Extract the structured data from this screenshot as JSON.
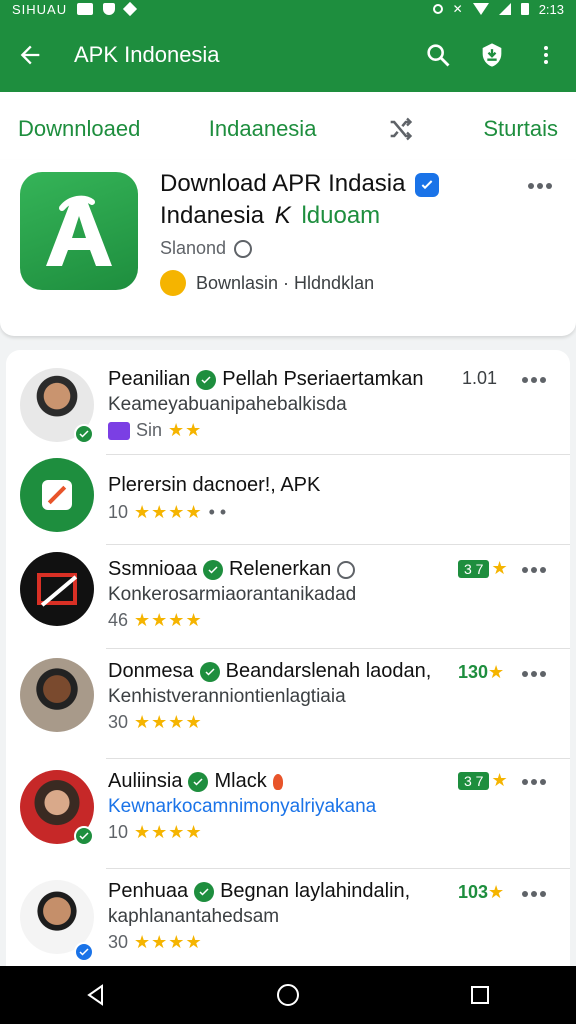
{
  "status_bar": {
    "left_text": "SIHUAU",
    "right_text": "2:13"
  },
  "app_bar": {
    "title": "APK Indonesia"
  },
  "tabs": [
    {
      "label": "Downnloaed"
    },
    {
      "label": "Indaanesia"
    },
    {
      "label": "Sturtais"
    }
  ],
  "hero": {
    "title_line1": "Download APR Indasia",
    "title_line2_main": "Indanesia",
    "title_line2_k": "K",
    "title_line2_accent": "lduoam",
    "sub_text": "Slanond",
    "meta_text": "Bownlasin · Hldndklan"
  },
  "rows": [
    {
      "title": "Peanilian",
      "title_tail": "Pellah Pseriaertamkan",
      "side_value": "1.01",
      "desc": "Keameyabuanipahebalkisda",
      "meta_count": "Sin",
      "stars": "★★",
      "has_more": true,
      "badge_color": "#1e8e3e",
      "desc_link": false
    },
    {
      "title": "Plerersin dacnoer!, APK",
      "title_tail": "",
      "side_value": "",
      "desc": "",
      "meta_count": "10",
      "stars": "★★★★",
      "has_more": false,
      "badge_color": "",
      "desc_link": false
    },
    {
      "title": "Ssmnioaa",
      "title_tail": "Relenerkan",
      "side_value": "3 7",
      "desc": "Konkerosarmiaorantanikadad",
      "meta_count": "46",
      "stars": "★★★★",
      "has_more": true,
      "badge_color": "",
      "desc_link": false
    },
    {
      "title": "Donmesa",
      "title_tail": "Beandarslenah laodan,",
      "side_value": "130",
      "desc": "Kenhistveranniontienlagtiaia",
      "meta_count": "30",
      "stars": "★★★★",
      "has_more": true,
      "badge_color": "",
      "desc_link": false
    },
    {
      "title": "Auliinsia",
      "title_tail": "Mlack",
      "side_value": "3 7",
      "desc": "Kewnarkocamnimonyalriyakana",
      "meta_count": "10",
      "stars": "★★★★",
      "has_more": true,
      "badge_color": "#1e8e3e",
      "desc_link": true
    },
    {
      "title": "Penhuaa",
      "title_tail": "Begnan laylahindalin,",
      "side_value": "103",
      "desc": "kaphlanantahedsam",
      "meta_count": "30",
      "stars": "★★★★",
      "has_more": true,
      "badge_color": "#1a73e8",
      "desc_link": false
    }
  ],
  "colors": {
    "primary": "#1e8e3e",
    "accent_blue": "#1a73e8",
    "star": "#f5b400"
  },
  "icons": [
    "back-arrow-icon",
    "search-icon",
    "download-shield-icon",
    "more-vert-icon",
    "shuffle-icon",
    "verified-icon",
    "more-horiz-icon",
    "nav-back-icon",
    "nav-home-icon",
    "nav-recents-icon"
  ]
}
